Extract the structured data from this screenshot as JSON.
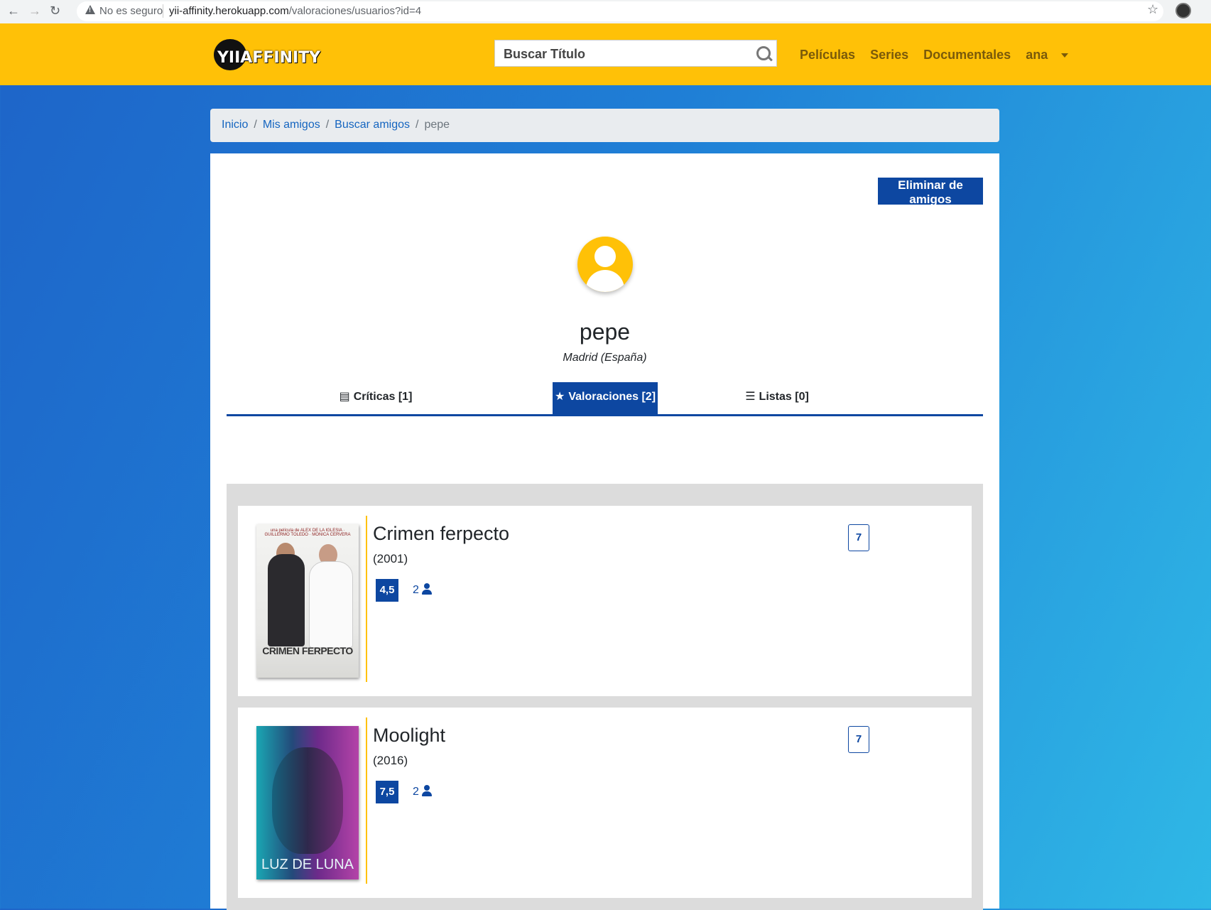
{
  "browser": {
    "security_label": "No es seguro",
    "url_host": "yii-affinity.herokuapp.com",
    "url_path": "/valoraciones/usuarios?id=4"
  },
  "navbar": {
    "logo_text": "YIIAFFINITY",
    "search_placeholder": "Buscar Título",
    "links": [
      "Películas",
      "Series",
      "Documentales"
    ],
    "user_menu": "ana"
  },
  "breadcrumb": {
    "items": [
      "Inicio",
      "Mis amigos",
      "Buscar amigos"
    ],
    "active": "pepe"
  },
  "profile": {
    "remove_button": "Eliminar de amigos",
    "username": "pepe",
    "location": "Madrid (España)"
  },
  "tabs": [
    {
      "label": "Críticas [1]",
      "icon": "newspaper-icon",
      "active": false
    },
    {
      "label": "Valoraciones [2]",
      "icon": "star-icon",
      "active": true
    },
    {
      "label": "Listas [0]",
      "icon": "list-icon",
      "active": false
    }
  ],
  "ratings": [
    {
      "title": "Crimen ferpecto",
      "year": "(2001)",
      "average": "4,5",
      "votes": "2",
      "user_score": "7",
      "poster_title": "CRIMEN FERPECTO",
      "poster_top": "una película de ALEX DE LA IGLESIA · GUILLERMO TOLEDO · MONICA CERVERA"
    },
    {
      "title": "Moolight",
      "year": "(2016)",
      "average": "7,5",
      "votes": "2",
      "user_score": "7",
      "poster_title": "LUZ DE LUNA"
    }
  ],
  "colors": {
    "brand_yellow": "#ffc107",
    "primary_blue": "#0d47a1"
  }
}
